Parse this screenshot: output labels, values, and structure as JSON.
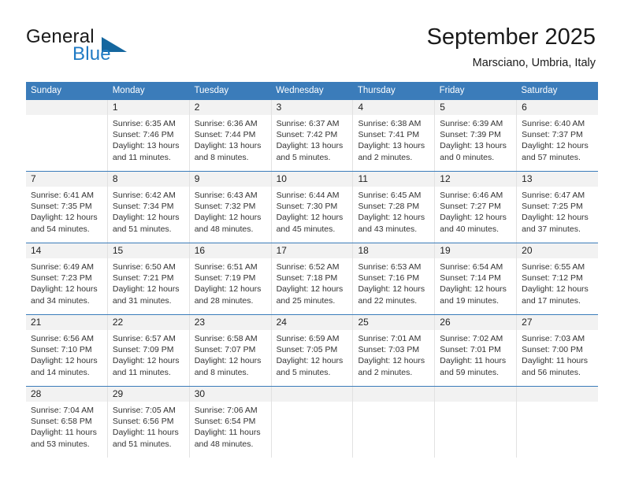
{
  "brand": {
    "name_top": "General",
    "name_bottom": "Blue",
    "accent_color": "#1f7ac4",
    "triangle_color": "#15679f"
  },
  "header": {
    "title": "September 2025",
    "subtitle": "Marsciano, Umbria, Italy",
    "header_bg_color": "#3b7cba",
    "row_divider_color": "#3b7cba",
    "daynum_band_color": "#f2f2f2"
  },
  "weekdays": [
    "Sunday",
    "Monday",
    "Tuesday",
    "Wednesday",
    "Thursday",
    "Friday",
    "Saturday"
  ],
  "weeks": [
    [
      {
        "day": "",
        "l1": "",
        "l2": "",
        "l3": "",
        "l4": ""
      },
      {
        "day": "1",
        "l1": "Sunrise: 6:35 AM",
        "l2": "Sunset: 7:46 PM",
        "l3": "Daylight: 13 hours",
        "l4": "and 11 minutes."
      },
      {
        "day": "2",
        "l1": "Sunrise: 6:36 AM",
        "l2": "Sunset: 7:44 PM",
        "l3": "Daylight: 13 hours",
        "l4": "and 8 minutes."
      },
      {
        "day": "3",
        "l1": "Sunrise: 6:37 AM",
        "l2": "Sunset: 7:42 PM",
        "l3": "Daylight: 13 hours",
        "l4": "and 5 minutes."
      },
      {
        "day": "4",
        "l1": "Sunrise: 6:38 AM",
        "l2": "Sunset: 7:41 PM",
        "l3": "Daylight: 13 hours",
        "l4": "and 2 minutes."
      },
      {
        "day": "5",
        "l1": "Sunrise: 6:39 AM",
        "l2": "Sunset: 7:39 PM",
        "l3": "Daylight: 13 hours",
        "l4": "and 0 minutes."
      },
      {
        "day": "6",
        "l1": "Sunrise: 6:40 AM",
        "l2": "Sunset: 7:37 PM",
        "l3": "Daylight: 12 hours",
        "l4": "and 57 minutes."
      }
    ],
    [
      {
        "day": "7",
        "l1": "Sunrise: 6:41 AM",
        "l2": "Sunset: 7:35 PM",
        "l3": "Daylight: 12 hours",
        "l4": "and 54 minutes."
      },
      {
        "day": "8",
        "l1": "Sunrise: 6:42 AM",
        "l2": "Sunset: 7:34 PM",
        "l3": "Daylight: 12 hours",
        "l4": "and 51 minutes."
      },
      {
        "day": "9",
        "l1": "Sunrise: 6:43 AM",
        "l2": "Sunset: 7:32 PM",
        "l3": "Daylight: 12 hours",
        "l4": "and 48 minutes."
      },
      {
        "day": "10",
        "l1": "Sunrise: 6:44 AM",
        "l2": "Sunset: 7:30 PM",
        "l3": "Daylight: 12 hours",
        "l4": "and 45 minutes."
      },
      {
        "day": "11",
        "l1": "Sunrise: 6:45 AM",
        "l2": "Sunset: 7:28 PM",
        "l3": "Daylight: 12 hours",
        "l4": "and 43 minutes."
      },
      {
        "day": "12",
        "l1": "Sunrise: 6:46 AM",
        "l2": "Sunset: 7:27 PM",
        "l3": "Daylight: 12 hours",
        "l4": "and 40 minutes."
      },
      {
        "day": "13",
        "l1": "Sunrise: 6:47 AM",
        "l2": "Sunset: 7:25 PM",
        "l3": "Daylight: 12 hours",
        "l4": "and 37 minutes."
      }
    ],
    [
      {
        "day": "14",
        "l1": "Sunrise: 6:49 AM",
        "l2": "Sunset: 7:23 PM",
        "l3": "Daylight: 12 hours",
        "l4": "and 34 minutes."
      },
      {
        "day": "15",
        "l1": "Sunrise: 6:50 AM",
        "l2": "Sunset: 7:21 PM",
        "l3": "Daylight: 12 hours",
        "l4": "and 31 minutes."
      },
      {
        "day": "16",
        "l1": "Sunrise: 6:51 AM",
        "l2": "Sunset: 7:19 PM",
        "l3": "Daylight: 12 hours",
        "l4": "and 28 minutes."
      },
      {
        "day": "17",
        "l1": "Sunrise: 6:52 AM",
        "l2": "Sunset: 7:18 PM",
        "l3": "Daylight: 12 hours",
        "l4": "and 25 minutes."
      },
      {
        "day": "18",
        "l1": "Sunrise: 6:53 AM",
        "l2": "Sunset: 7:16 PM",
        "l3": "Daylight: 12 hours",
        "l4": "and 22 minutes."
      },
      {
        "day": "19",
        "l1": "Sunrise: 6:54 AM",
        "l2": "Sunset: 7:14 PM",
        "l3": "Daylight: 12 hours",
        "l4": "and 19 minutes."
      },
      {
        "day": "20",
        "l1": "Sunrise: 6:55 AM",
        "l2": "Sunset: 7:12 PM",
        "l3": "Daylight: 12 hours",
        "l4": "and 17 minutes."
      }
    ],
    [
      {
        "day": "21",
        "l1": "Sunrise: 6:56 AM",
        "l2": "Sunset: 7:10 PM",
        "l3": "Daylight: 12 hours",
        "l4": "and 14 minutes."
      },
      {
        "day": "22",
        "l1": "Sunrise: 6:57 AM",
        "l2": "Sunset: 7:09 PM",
        "l3": "Daylight: 12 hours",
        "l4": "and 11 minutes."
      },
      {
        "day": "23",
        "l1": "Sunrise: 6:58 AM",
        "l2": "Sunset: 7:07 PM",
        "l3": "Daylight: 12 hours",
        "l4": "and 8 minutes."
      },
      {
        "day": "24",
        "l1": "Sunrise: 6:59 AM",
        "l2": "Sunset: 7:05 PM",
        "l3": "Daylight: 12 hours",
        "l4": "and 5 minutes."
      },
      {
        "day": "25",
        "l1": "Sunrise: 7:01 AM",
        "l2": "Sunset: 7:03 PM",
        "l3": "Daylight: 12 hours",
        "l4": "and 2 minutes."
      },
      {
        "day": "26",
        "l1": "Sunrise: 7:02 AM",
        "l2": "Sunset: 7:01 PM",
        "l3": "Daylight: 11 hours",
        "l4": "and 59 minutes."
      },
      {
        "day": "27",
        "l1": "Sunrise: 7:03 AM",
        "l2": "Sunset: 7:00 PM",
        "l3": "Daylight: 11 hours",
        "l4": "and 56 minutes."
      }
    ],
    [
      {
        "day": "28",
        "l1": "Sunrise: 7:04 AM",
        "l2": "Sunset: 6:58 PM",
        "l3": "Daylight: 11 hours",
        "l4": "and 53 minutes."
      },
      {
        "day": "29",
        "l1": "Sunrise: 7:05 AM",
        "l2": "Sunset: 6:56 PM",
        "l3": "Daylight: 11 hours",
        "l4": "and 51 minutes."
      },
      {
        "day": "30",
        "l1": "Sunrise: 7:06 AM",
        "l2": "Sunset: 6:54 PM",
        "l3": "Daylight: 11 hours",
        "l4": "and 48 minutes."
      },
      {
        "day": "",
        "l1": "",
        "l2": "",
        "l3": "",
        "l4": ""
      },
      {
        "day": "",
        "l1": "",
        "l2": "",
        "l3": "",
        "l4": ""
      },
      {
        "day": "",
        "l1": "",
        "l2": "",
        "l3": "",
        "l4": ""
      },
      {
        "day": "",
        "l1": "",
        "l2": "",
        "l3": "",
        "l4": ""
      }
    ]
  ]
}
